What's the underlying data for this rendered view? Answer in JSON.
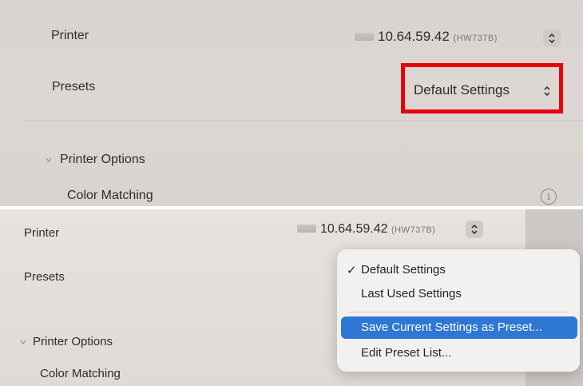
{
  "top": {
    "printer_label": "Printer",
    "printer_ip": "10.64.59.42",
    "printer_model": "(HW737B)",
    "presets_label": "Presets",
    "presets_value": "Default Settings",
    "section_label": "Printer Options",
    "color_matching_label": "Color Matching",
    "info_glyph": "i"
  },
  "bottom": {
    "printer_label": "Printer",
    "printer_ip": "10.64.59.42",
    "printer_model": "(HW737B)",
    "presets_label": "Presets",
    "section_label": "Printer Options",
    "color_matching_label": "Color Matching",
    "menu": {
      "check_glyph": "✓",
      "items": [
        "Default Settings",
        "Last Used Settings",
        "Save Current Settings as Preset...",
        "Edit Preset List..."
      ],
      "selected_index": 0,
      "highlighted_index": 2
    }
  },
  "colors": {
    "highlight_box": "#e8000b",
    "menu_highlight": "#2f77d4"
  }
}
